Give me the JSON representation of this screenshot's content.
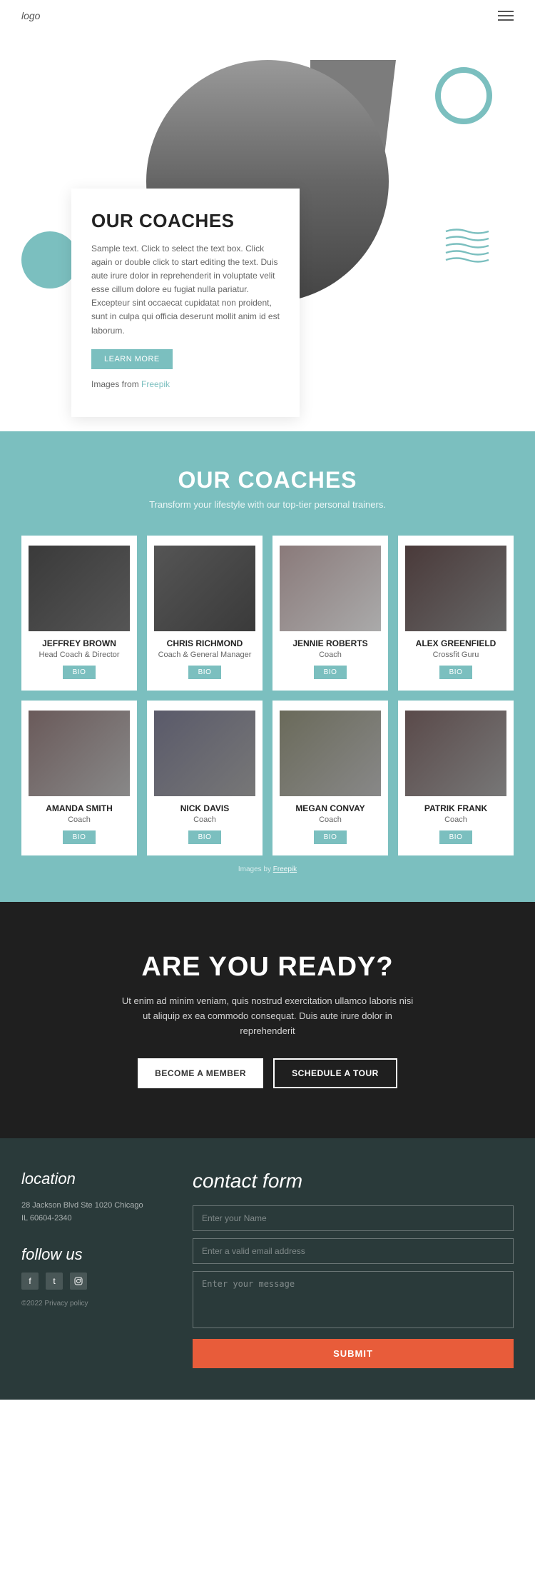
{
  "header": {
    "logo": "logo",
    "menu_icon": "≡"
  },
  "hero": {
    "card": {
      "title": "OUR COACHES",
      "description": "Sample text. Click to select the text box. Click again or double click to start editing the text. Duis aute irure dolor in reprehenderit in voluptate velit esse cillum dolore eu fugiat nulla pariatur. Excepteur sint occaecat cupidatat non proident, sunt in culpa qui officia deserunt mollit anim id est laborum.",
      "button": "LEARN MORE",
      "images_note": "Images from ",
      "freepik": "Freepik"
    }
  },
  "coaches_section": {
    "title": "OUR COACHES",
    "subtitle": "Transform your lifestyle with our top-tier personal trainers.",
    "coaches": [
      {
        "name": "Jeffrey Brown",
        "role": "Head Coach & Director",
        "bio_label": "BIO"
      },
      {
        "name": "CHRIS RICHMOND",
        "role": "Coach & General Manager",
        "bio_label": "BIO"
      },
      {
        "name": "JENNIE ROBERTS",
        "role": "Coach",
        "bio_label": "BIO"
      },
      {
        "name": "ALEX GREENFIELD",
        "role": "Crossfit Guru",
        "bio_label": "BIO"
      },
      {
        "name": "AMANDA SMITH",
        "role": "Coach",
        "bio_label": "BIO"
      },
      {
        "name": "NICK DAVIS",
        "role": "Coach",
        "bio_label": "BIO"
      },
      {
        "name": "MEGAN CONVAY",
        "role": "Coach",
        "bio_label": "BIO"
      },
      {
        "name": "PATRIK FRANK",
        "role": "Coach",
        "bio_label": "BIO"
      }
    ],
    "freepik_note": "Images by ",
    "freepik_link": "Freepik"
  },
  "ready_section": {
    "title": "ARE YOU READY?",
    "description": "Ut enim ad minim veniam, quis nostrud exercitation ullamco laboris nisi ut aliquip ex ea commodo consequat. Duis aute irure dolor in reprehenderit",
    "btn1": "BECOME A MEMBER",
    "btn2": "SCHEDULE A TOUR"
  },
  "footer": {
    "location": {
      "title": "location",
      "address_line1": "28 Jackson Blvd Ste 1020 Chicago",
      "address_line2": "IL 60604-2340"
    },
    "follow": {
      "title": "follow us",
      "privacy": "©2022 Privacy policy"
    },
    "contact": {
      "title": "contact form",
      "name_placeholder": "Enter your Name",
      "email_placeholder": "Enter a valid email address",
      "message_placeholder": "Enter your message",
      "submit_label": "SUBMIT"
    }
  }
}
